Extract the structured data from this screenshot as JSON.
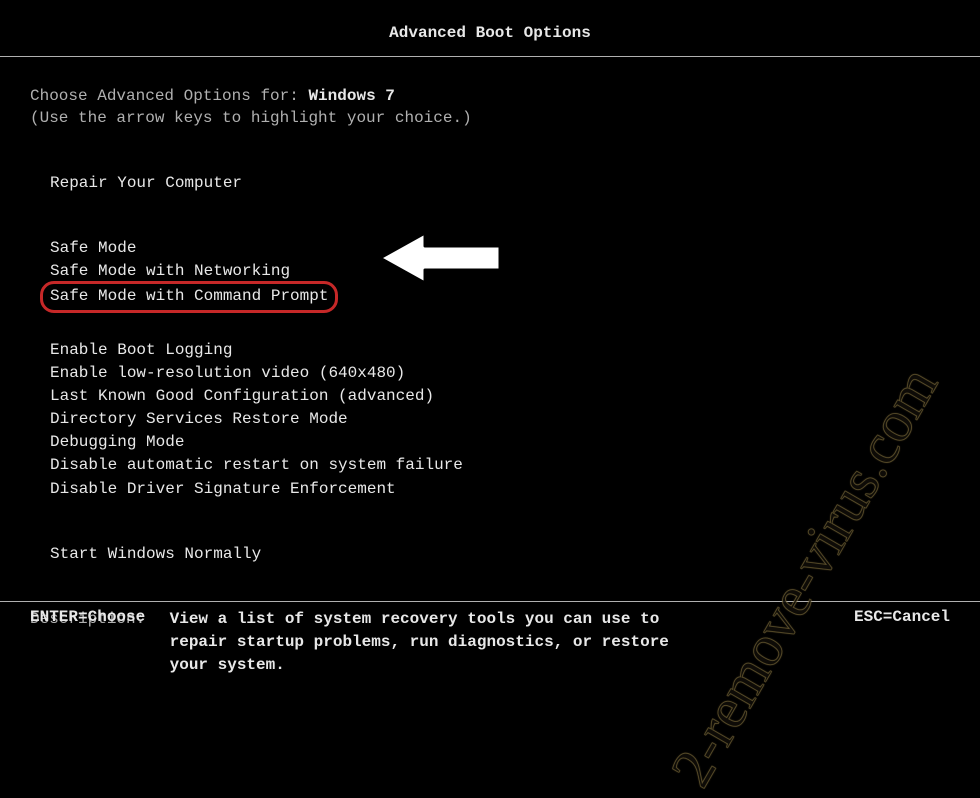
{
  "title": "Advanced Boot Options",
  "intro": {
    "prefix": "Choose Advanced Options for: ",
    "os": "Windows 7",
    "hint": "(Use the arrow keys to highlight your choice.)"
  },
  "groups": {
    "repair": "Repair Your Computer",
    "safe": [
      "Safe Mode",
      "Safe Mode with Networking",
      "Safe Mode with Command Prompt"
    ],
    "advanced": [
      "Enable Boot Logging",
      "Enable low-resolution video (640x480)",
      "Last Known Good Configuration (advanced)",
      "Directory Services Restore Mode",
      "Debugging Mode",
      "Disable automatic restart on system failure",
      "Disable Driver Signature Enforcement"
    ],
    "normal": "Start Windows Normally"
  },
  "description": {
    "label": "Description:",
    "text": "View a list of system recovery tools you can use to repair startup problems, run diagnostics, or restore your system."
  },
  "footer": {
    "enter": "ENTER=Choose",
    "esc": "ESC=Cancel"
  },
  "watermark": "2-remove-virus.com"
}
